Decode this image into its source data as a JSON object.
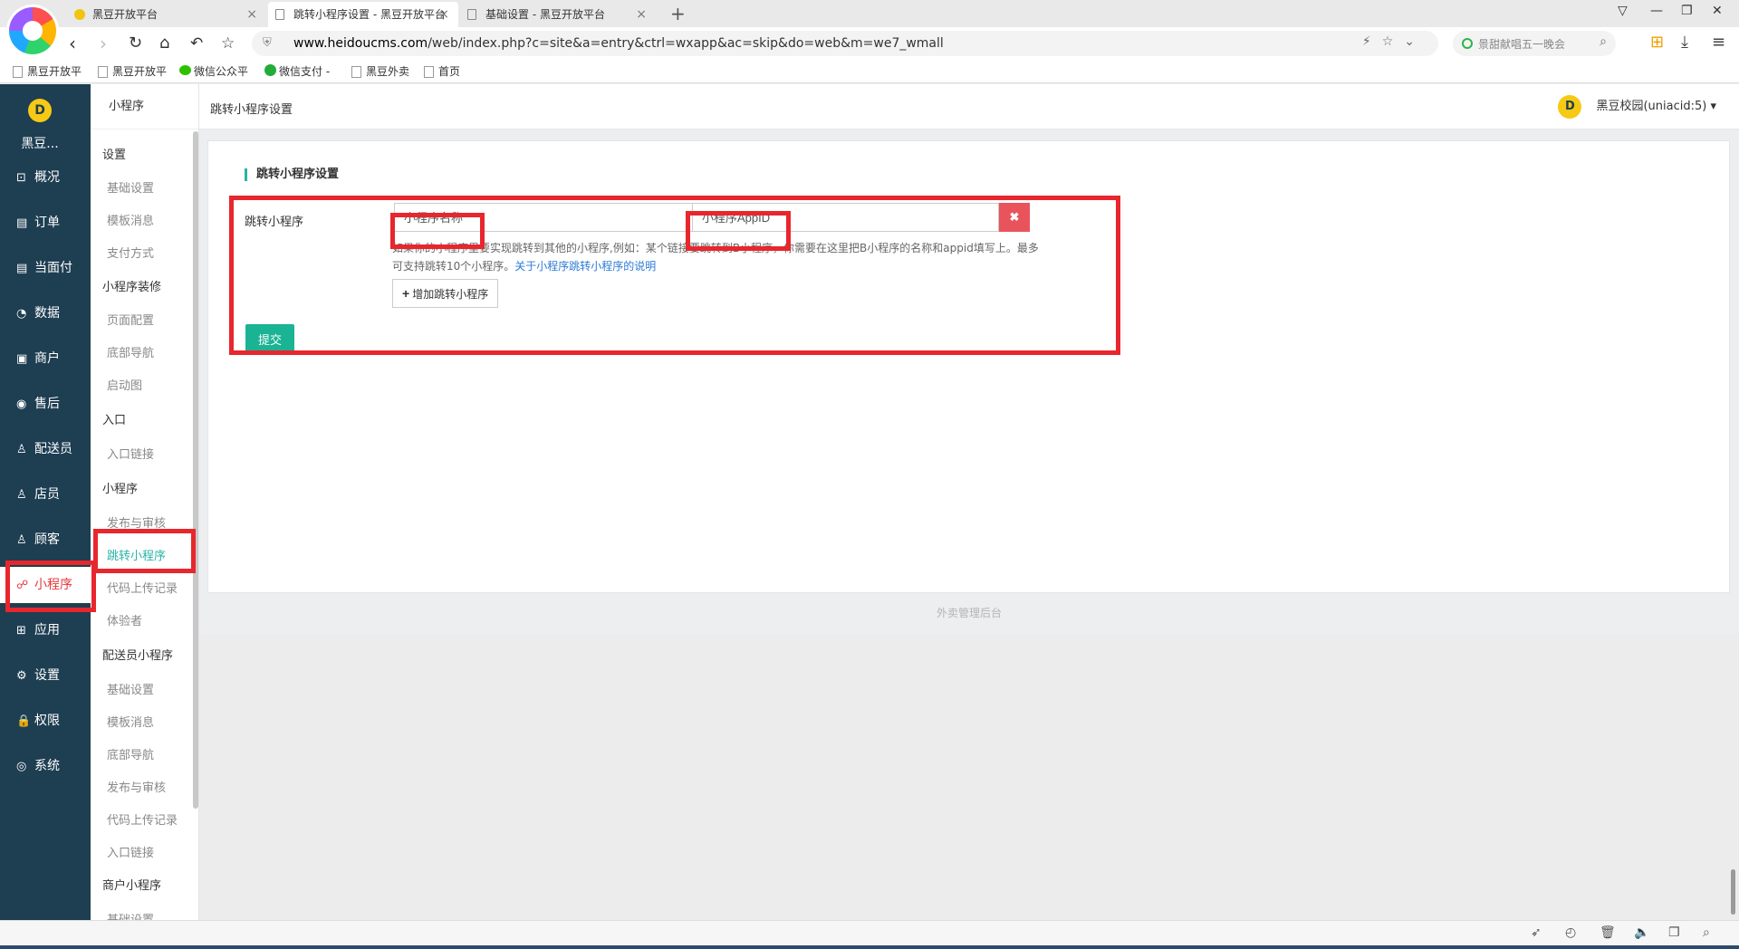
{
  "browser": {
    "tabs": [
      {
        "title": "黑豆开放平台",
        "active": false
      },
      {
        "title": "跳转小程序设置 - 黑豆开放平台",
        "active": true
      },
      {
        "title": "基础设置 - 黑豆开放平台",
        "active": false
      }
    ],
    "new_tab": "+",
    "url_domain": "www.heidoucms.com",
    "url_path": "/web/index.php?c=site&a=entry&ctrl=wxapp&ac=skip&do=web&m=we7_wmall",
    "search_text": "景甜献唱五一晚会",
    "bookmarks": [
      "黑豆开放平",
      "黑豆开放平",
      "微信公众平",
      "微信支付 -",
      "黑豆外卖",
      "首页"
    ]
  },
  "sidebar": {
    "brand_logo": "D",
    "brand_name": "黑豆...",
    "items": [
      {
        "label": "概况",
        "icon": "dashboard-icon",
        "glyph": "⊡"
      },
      {
        "label": "订单",
        "icon": "order-icon",
        "glyph": "▤"
      },
      {
        "label": "当面付",
        "icon": "pay-icon",
        "glyph": "▤"
      },
      {
        "label": "数据",
        "icon": "chart-icon",
        "glyph": "◔"
      },
      {
        "label": "商户",
        "icon": "store-icon",
        "glyph": "▣"
      },
      {
        "label": "售后",
        "icon": "service-icon",
        "glyph": "◉"
      },
      {
        "label": "配送员",
        "icon": "courier-icon",
        "glyph": "♙"
      },
      {
        "label": "店员",
        "icon": "clerk-icon",
        "glyph": "♙"
      },
      {
        "label": "顾客",
        "icon": "customer-icon",
        "glyph": "♙"
      },
      {
        "label": "小程序",
        "icon": "miniapp-icon",
        "glyph": "☍"
      },
      {
        "label": "应用",
        "icon": "apps-icon",
        "glyph": "⊞"
      },
      {
        "label": "设置",
        "icon": "settings-icon",
        "glyph": "⚙"
      },
      {
        "label": "权限",
        "icon": "lock-icon",
        "glyph": "🔒"
      },
      {
        "label": "系统",
        "icon": "system-icon",
        "glyph": "◎"
      }
    ]
  },
  "subnav": {
    "title": "小程序",
    "groups": [
      {
        "label": "设置",
        "items": [
          "基础设置",
          "模板消息",
          "支付方式"
        ]
      },
      {
        "label": "小程序装修",
        "items": [
          "页面配置",
          "底部导航",
          "启动图"
        ]
      },
      {
        "label": "入口",
        "items": [
          "入口链接"
        ]
      },
      {
        "label": "小程序",
        "items": [
          "发布与审核",
          "跳转小程序",
          "代码上传记录",
          "体验者"
        ]
      },
      {
        "label": "配送员小程序",
        "items": [
          "基础设置",
          "模板消息",
          "底部导航",
          "发布与审核",
          "代码上传记录",
          "入口链接"
        ]
      },
      {
        "label": "商户小程序",
        "items": [
          "基础设置"
        ]
      }
    ]
  },
  "topbar": {
    "title": "跳转小程序设置",
    "account": "黑豆校园(uniacid:5)",
    "account_logo": "D",
    "caret": "▾"
  },
  "form": {
    "section_title": "跳转小程序设置",
    "field_label": "跳转小程序",
    "name_placeholder": "小程序名称",
    "appid_placeholder": "小程序AppID",
    "remove_label": "✖",
    "help_text": "如果你的小程序里要实现跳转到其他的小程序,例如：某个链接要跳转到B小程序，你需要在这里把B小程序的名称和appid填写上。最多可支持跳转10个小程序。",
    "help_link": "关于小程序跳转小程序的说明",
    "add_label": "增加跳转小程序",
    "submit_label": "提交"
  },
  "footer": {
    "text": "外卖管理后台"
  }
}
